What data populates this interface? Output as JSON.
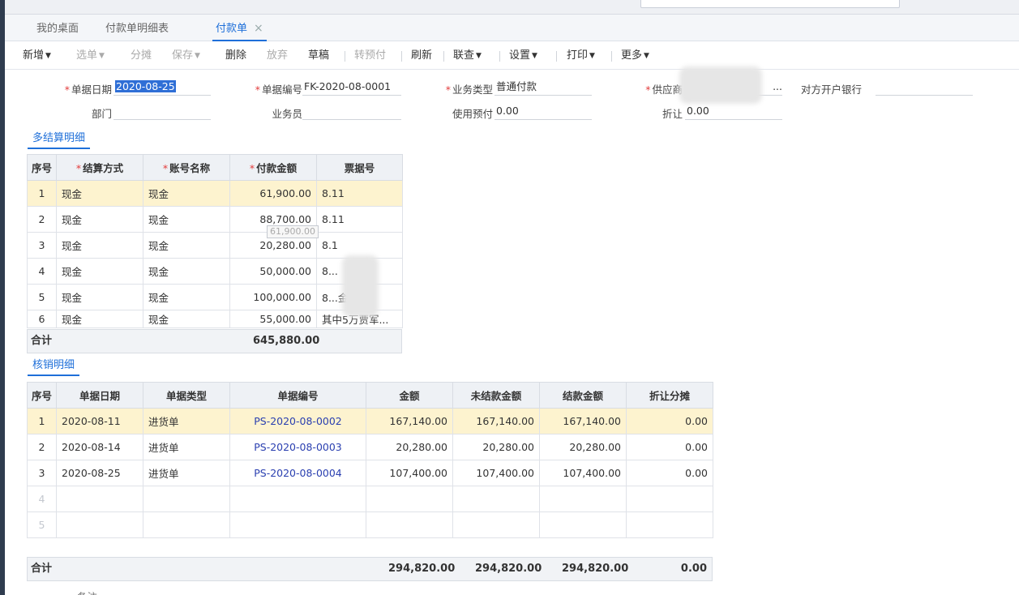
{
  "tabs": [
    {
      "label": "我的桌面"
    },
    {
      "label": "付款单明细表"
    },
    {
      "label": "付款单",
      "close": "×"
    }
  ],
  "toolbar": {
    "new": "新增",
    "select": "选单",
    "split": "分摊",
    "save": "保存",
    "delete": "删除",
    "abandon": "放弃",
    "draft": "草稿",
    "to_prepay": "转预付",
    "refresh": "刷新",
    "link_query": "联查",
    "settings": "设置",
    "print": "打印",
    "more": "更多"
  },
  "form": {
    "date_label": "单据日期",
    "date_value": "2020-08-25",
    "number_label": "单据编号",
    "number_value": "FK-2020-08-0001",
    "biz_type_label": "业务类型",
    "biz_type_value": "普通付款",
    "supplier_label": "供应商",
    "supplier_value": "...",
    "bank_label": "对方开户银行",
    "bank_value": "",
    "dept_label": "部门",
    "dept_value": "",
    "staff_label": "业务员",
    "staff_value": "",
    "prepay_label": "使用预付",
    "prepay_value": "0.00",
    "discount_label": "折让",
    "discount_value": "0.00"
  },
  "settlement": {
    "title": "多结算明细",
    "headers": [
      "序号",
      "结算方式",
      "账号名称",
      "付款金额",
      "票据号"
    ],
    "rows": [
      [
        "1",
        "现金",
        "现金",
        "61,900.00",
        "8.11"
      ],
      [
        "2",
        "现金",
        "现金",
        "88,700.00",
        "8.11"
      ],
      [
        "3",
        "现金",
        "现金",
        "20,280.00",
        "8.1"
      ],
      [
        "4",
        "现金",
        "现金",
        "50,000.00",
        "8..."
      ],
      [
        "5",
        "现金",
        "现金",
        "100,000.00",
        "8...金"
      ],
      [
        "6",
        "现金",
        "现金",
        "55,000.00",
        "其中5万贾军..."
      ]
    ],
    "tooltip": "61,900.00",
    "total_label": "合计",
    "total_value": "645,880.00"
  },
  "writeoff": {
    "title": "核销明细",
    "headers": [
      "序号",
      "单据日期",
      "单据类型",
      "单据编号",
      "金额",
      "未结款金额",
      "结款金额",
      "折让分摊"
    ],
    "rows": [
      [
        "1",
        "2020-08-11",
        "进货单",
        "PS-2020-08-0002",
        "167,140.00",
        "167,140.00",
        "167,140.00",
        "0.00"
      ],
      [
        "2",
        "2020-08-14",
        "进货单",
        "PS-2020-08-0003",
        "20,280.00",
        "20,280.00",
        "20,280.00",
        "0.00"
      ],
      [
        "3",
        "2020-08-25",
        "进货单",
        "PS-2020-08-0004",
        "107,400.00",
        "107,400.00",
        "107,400.00",
        "0.00"
      ],
      [
        "4",
        "",
        "",
        "",
        "",
        "",
        "",
        ""
      ],
      [
        "5",
        "",
        "",
        "",
        "",
        "",
        "",
        ""
      ]
    ],
    "total_label": "合计",
    "total_amount": "294,820.00",
    "total_unsettled": "294,820.00",
    "total_settled": "294,820.00",
    "total_discount": "0.00"
  },
  "remark_label": "备注",
  "colors": {
    "accent": "#1e6fd9",
    "highlight_row": "#fdf3cf",
    "required": "#e23b3b"
  }
}
